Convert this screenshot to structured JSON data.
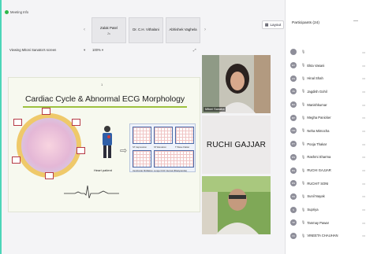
{
  "app": {
    "meeting_info": "Meeting Info",
    "viewing": "Viewing Mitoni Sanatra's screen",
    "zoom": "100%",
    "layout_label": "Layout"
  },
  "top_tiles": [
    {
      "name": "Zalak Patel",
      "sub": "Zs"
    },
    {
      "name": "Dr. C.H. Vithalani",
      "sub": ""
    },
    {
      "name": "Abhishek Vaghela",
      "sub": ""
    }
  ],
  "slide": {
    "page": "1",
    "title": "Cardiac Cycle & Abnormal ECG Morphology",
    "person_label": "Heart patient",
    "grid_labels": [
      "ST depression",
      "ST Elevation",
      "T Wave Flatter",
      "Ventricular fibrillation",
      "Longer R-R interval (Bradycardia)"
    ]
  },
  "videos": [
    {
      "label": "Mitoni Sanatra"
    },
    {
      "name": "RUCHI GAJJAR"
    },
    {
      "label": ""
    }
  ],
  "participants": {
    "title": "Participants (24)",
    "list": [
      {
        "initials": "",
        "name": ""
      },
      {
        "initials": "EV",
        "name": "Ekta Vasani"
      },
      {
        "initials": "HS",
        "name": "Hinal Shah"
      },
      {
        "initials": "JG",
        "name": "Jagdish Gohil"
      },
      {
        "initials": "MA",
        "name": "Manishkumar"
      },
      {
        "initials": "MP",
        "name": "Megha Panicker"
      },
      {
        "initials": "NM",
        "name": "Neha Mimocha"
      },
      {
        "initials": "PT",
        "name": "Pooja Thakar"
      },
      {
        "initials": "RS",
        "name": "Rashmi Sharma"
      },
      {
        "initials": "RG",
        "name": "RUCHI GAJJAR"
      },
      {
        "initials": "RS",
        "name": "RUCHIT SONI"
      },
      {
        "initials": "SN",
        "name": "Sunil Nayak"
      },
      {
        "initials": "S",
        "name": "Supriya"
      },
      {
        "initials": "TP",
        "name": "Tanmay Pawar"
      },
      {
        "initials": "VC",
        "name": "VINEETA CHAUHAN"
      }
    ]
  }
}
